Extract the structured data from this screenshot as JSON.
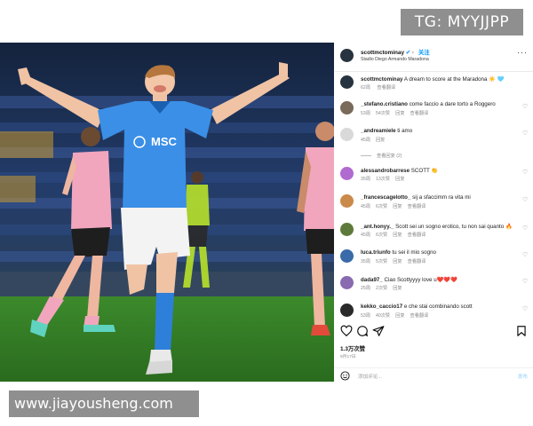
{
  "watermarks": {
    "top_right": "TG: MYYJJPP",
    "bottom_left": "www.jiayousheng.com"
  },
  "post": {
    "author": "scottmctominay",
    "verified_icon": "verified-badge-icon",
    "follow_label": "关注",
    "location": "Stadio Diego Armando Maradona",
    "more_icon": "more-options-icon",
    "caption": {
      "user": "scottmctominay",
      "text": "A dream to score at the Maradona ☀️ 🩵",
      "time": "62周",
      "translate": "查看翻译"
    },
    "photo": {
      "shirt_sponsor": "MSC",
      "shirt_color": "#3b8fe6",
      "shorts_color": "#f3f3f3",
      "opponent_kit": "#f1a6bd",
      "pitch_color": "#2f7a24"
    },
    "likes": "1.3万次赞",
    "date": "9月17日",
    "comment_placeholder": "添加评论...",
    "post_label": "发布"
  },
  "comments": [
    {
      "user": "_stefano.cristiano",
      "text": "come faccio a dare torto a Roggero",
      "time": "53周",
      "likes": "54次赞",
      "reply": "回复",
      "translate": "查看翻译",
      "avatar_color": "#7a6a5a"
    },
    {
      "user": "_andreamiele",
      "text": "ti amo",
      "time": "45周",
      "likes": "",
      "reply": "回复",
      "translate": "",
      "avatar_color": "#d9d9d9",
      "replies": "查看回复 (2)"
    },
    {
      "user": "alessandrobarrese",
      "text": "SCOTT 👏",
      "time": "35周",
      "likes": "13次赞",
      "reply": "回复",
      "translate": "",
      "avatar_color": "#b06ad0"
    },
    {
      "user": "_francescagelotto_",
      "text": "sij a sfaccimm ra vita mi",
      "time": "45周",
      "likes": "6次赞",
      "reply": "回复",
      "translate": "查看翻译",
      "avatar_color": "#c98a4a"
    },
    {
      "user": "_ant.honyy._",
      "text": "Scott sei un sogno erotico, tu non sai quanto 🔥",
      "time": "45周",
      "likes": "6次赞",
      "reply": "回复",
      "translate": "查看翻译",
      "avatar_color": "#5e7a3a"
    },
    {
      "user": "luca.triunfo",
      "text": "tu sei il mio sogno",
      "time": "35周",
      "likes": "5次赞",
      "reply": "回复",
      "translate": "查看翻译",
      "avatar_color": "#3a6aa8"
    },
    {
      "user": "dada97_",
      "text": "Ciao Scottyyyy love u❤️❤️❤️",
      "time": "25周",
      "likes": "2次赞",
      "reply": "回复",
      "translate": "",
      "avatar_color": "#8a6ab0"
    },
    {
      "user": "kekko_caccio17",
      "text": "e che stai combinando scott",
      "time": "53周",
      "likes": "40次赞",
      "reply": "回复",
      "translate": "查看翻译",
      "avatar_color": "#2a2a2a"
    }
  ],
  "actions": {
    "like_icon": "heart-icon",
    "comment_icon": "comment-bubble-icon",
    "share_icon": "paper-plane-icon",
    "save_icon": "bookmark-icon",
    "emoji_icon": "emoji-smile-icon"
  }
}
